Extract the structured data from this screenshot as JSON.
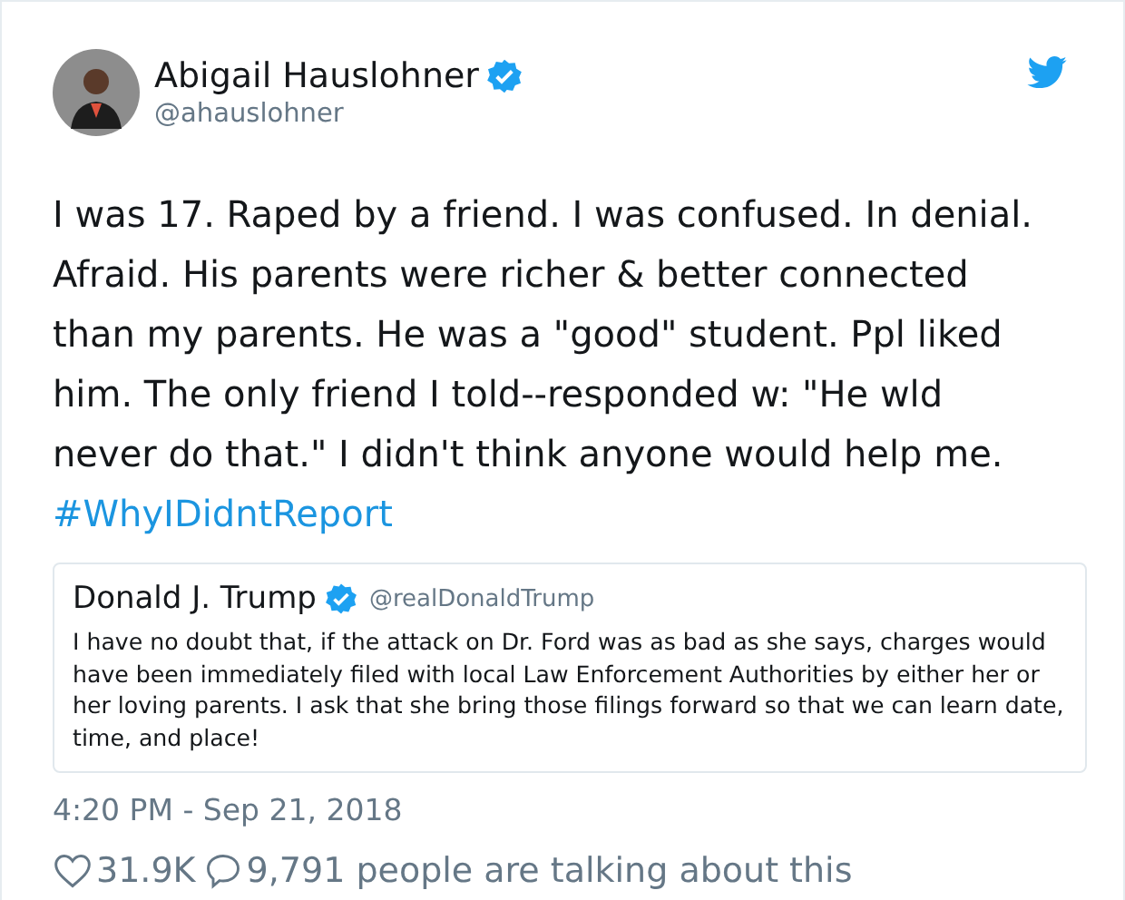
{
  "author": {
    "name": "Abigail Hauslohner",
    "handle": "@ahauslohner",
    "verified": true
  },
  "tweet": {
    "text": "I was 17. Raped by a friend. I was confused. In denial. Afraid. His parents were richer & better connected than my parents. He was a \"good\" student. Ppl liked him. The only friend I told--responded w: \"He wld never do that.\" I didn't think anyone would help me.",
    "hashtag": "#WhyIDidntReport"
  },
  "quoted_tweet": {
    "name": "Donald J. Trump",
    "handle": "@realDonaldTrump",
    "verified": true,
    "text": "I have no doubt that, if the attack on Dr. Ford was as bad as she says, charges would have been immediately filed with local Law Enforcement Authorities by either her or her loving parents. I ask that she bring those filings forward so that we can learn  date, time, and place!"
  },
  "timestamp": "4:20 PM - Sep 21, 2018",
  "stats": {
    "likes": "31.9K",
    "talking": "9,791 people are talking about this"
  }
}
